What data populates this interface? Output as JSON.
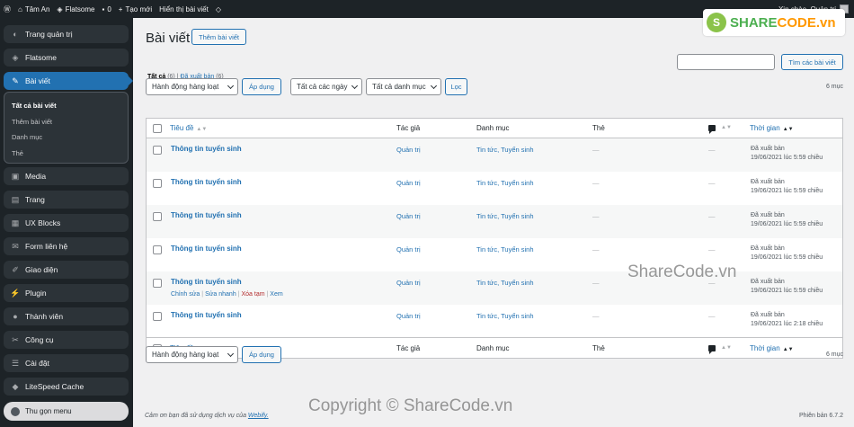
{
  "adminbar": {
    "site_name": "Tâm An",
    "theme": "Flatsome",
    "comments_count": "0",
    "new_label": "Tạo mới",
    "view_posts": "Hiển thị bài viết",
    "greeting": "Xin chào, Quản trị"
  },
  "sidebar": {
    "items": [
      {
        "label": "Trang quản trị",
        "icon": "dashboard-icon"
      },
      {
        "label": "Flatsome",
        "icon": "flatsome-icon"
      },
      {
        "label": "Bài viết",
        "icon": "pin-icon"
      },
      {
        "label": "Media",
        "icon": "media-icon"
      },
      {
        "label": "Trang",
        "icon": "page-icon"
      },
      {
        "label": "UX Blocks",
        "icon": "blocks-icon"
      },
      {
        "label": "Form liên hệ",
        "icon": "mail-icon"
      },
      {
        "label": "Giao diện",
        "icon": "brush-icon"
      },
      {
        "label": "Plugin",
        "icon": "plugin-icon"
      },
      {
        "label": "Thành viên",
        "icon": "user-icon"
      },
      {
        "label": "Công cụ",
        "icon": "wrench-icon"
      },
      {
        "label": "Cài đặt",
        "icon": "settings-icon"
      },
      {
        "label": "LiteSpeed Cache",
        "icon": "litespeed-icon"
      }
    ],
    "submenu": [
      "Tất cả bài viết",
      "Thêm bài viết",
      "Danh mục",
      "Thẻ"
    ],
    "collapse_label": "Thu gọn menu"
  },
  "page": {
    "title": "Bài viết",
    "add_new": "Thêm bài viết",
    "filter_all": "Tất cả",
    "filter_all_count": "(6)",
    "filter_published": "Đã xuất bản",
    "filter_published_count": "(6)",
    "search_placeholder": "",
    "search_button": "Tìm các bài viết",
    "bulk_action": "Hành động hàng loạt",
    "apply": "Áp dụng",
    "all_dates": "Tất cả các ngày",
    "all_categories": "Tất cả danh mục",
    "filter": "Lọc",
    "items_count": "6 mục"
  },
  "table": {
    "columns": {
      "title": "Tiêu đề",
      "author": "Tác giả",
      "categories": "Danh mục",
      "tags": "Thẻ",
      "date": "Thời gian"
    },
    "rows": [
      {
        "title": "Thông tin tuyển sinh",
        "author": "Quản trị",
        "categories": "Tin tức, Tuyển sinh",
        "tags": "—",
        "comments": "—",
        "status": "Đã xuất bản",
        "date": "19/06/2021 lúc 5:59 chiều"
      },
      {
        "title": "Thông tin tuyển sinh",
        "author": "Quản trị",
        "categories": "Tin tức, Tuyển sinh",
        "tags": "—",
        "comments": "—",
        "status": "Đã xuất bản",
        "date": "19/06/2021 lúc 5:59 chiều"
      },
      {
        "title": "Thông tin tuyển sinh",
        "author": "Quản trị",
        "categories": "Tin tức, Tuyển sinh",
        "tags": "—",
        "comments": "—",
        "status": "Đã xuất bản",
        "date": "19/06/2021 lúc 5:59 chiều"
      },
      {
        "title": "Thông tin tuyển sinh",
        "author": "Quản trị",
        "categories": "Tin tức, Tuyển sinh",
        "tags": "—",
        "comments": "—",
        "status": "Đã xuất bản",
        "date": "19/06/2021 lúc 5:59 chiều"
      },
      {
        "title": "Thông tin tuyển sinh",
        "author": "Quản trị",
        "categories": "Tin tức, Tuyển sinh",
        "tags": "—",
        "comments": "—",
        "status": "Đã xuất bản",
        "date": "19/06/2021 lúc 5:59 chiều"
      },
      {
        "title": "Thông tin tuyển sinh",
        "author": "Quản trị",
        "categories": "Tin tức, Tuyển sinh",
        "tags": "—",
        "comments": "—",
        "status": "Đã xuất bản",
        "date": "19/06/2021 lúc 2:18 chiều"
      }
    ],
    "row_actions": {
      "edit": "Chỉnh sửa",
      "quick_edit": "Sửa nhanh",
      "trash": "Xóa tạm",
      "view": "Xem"
    }
  },
  "footer": {
    "thanks": "Cảm ơn bạn đã sử dụng dịch vụ của",
    "brand": "Webify.",
    "version": "Phiên bản 6.7.2"
  },
  "watermark": {
    "logo_share": "SHARE",
    "logo_code": "CODE.vn",
    "center": "ShareCode.vn",
    "copyright": "Copyright © ShareCode.vn"
  }
}
